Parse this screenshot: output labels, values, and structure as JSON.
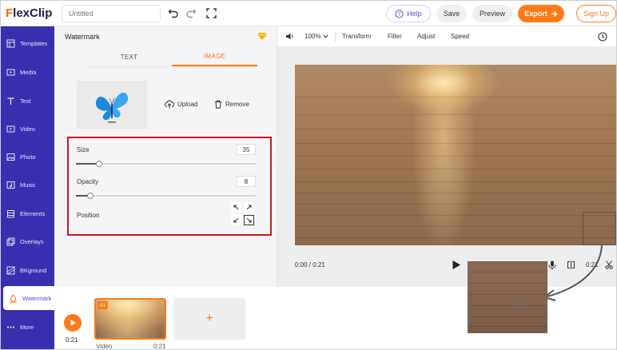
{
  "app": {
    "logo_first": "F",
    "logo_rest": "lexClip",
    "title_placeholder": "Untitled"
  },
  "header": {
    "help_label": "Help",
    "save_label": "Save",
    "preview_label": "Preview",
    "export_label": "Export",
    "signup_label": "Sign Up"
  },
  "sidebar": {
    "items": [
      {
        "label": "Templates",
        "icon": "templates-icon"
      },
      {
        "label": "Media",
        "icon": "media-icon"
      },
      {
        "label": "Text",
        "icon": "text-icon"
      },
      {
        "label": "Video",
        "icon": "video-icon"
      },
      {
        "label": "Photo",
        "icon": "photo-icon"
      },
      {
        "label": "Music",
        "icon": "music-icon"
      },
      {
        "label": "Elements",
        "icon": "elements-icon"
      },
      {
        "label": "Overlays",
        "icon": "overlays-icon"
      },
      {
        "label": "BKground",
        "icon": "background-icon"
      },
      {
        "label": "Watermark",
        "icon": "watermark-icon",
        "active": true
      },
      {
        "label": "More",
        "icon": "more-icon"
      }
    ]
  },
  "panel": {
    "title": "Watermark",
    "tabs": [
      {
        "label": "TEXT",
        "active": false
      },
      {
        "label": "IMAGE",
        "active": true
      }
    ],
    "upload_label": "Upload",
    "remove_label": "Remove",
    "size_label": "Size",
    "size_value": "35",
    "size_fraction": 0.13,
    "opacity_label": "Opacity",
    "opacity_value": "8",
    "opacity_fraction": 0.08,
    "position_label": "Position",
    "position_selected": "bottom-right"
  },
  "toolbar": {
    "zoom": "100%",
    "transform_label": "Transform",
    "filter_label": "Filter",
    "adjust_label": "Adjust",
    "speed_label": "Speed"
  },
  "player": {
    "timecode": "0:00 / 0:21",
    "duration_short": "0:21"
  },
  "timeline": {
    "time": "0:21",
    "clip_number": "01",
    "clip_label": "Video",
    "clip_duration": "0:21",
    "add_label": "+"
  },
  "colors": {
    "accent": "#ff7a1a",
    "sidebar": "#3a2fae",
    "highlight": "#d0161d"
  }
}
